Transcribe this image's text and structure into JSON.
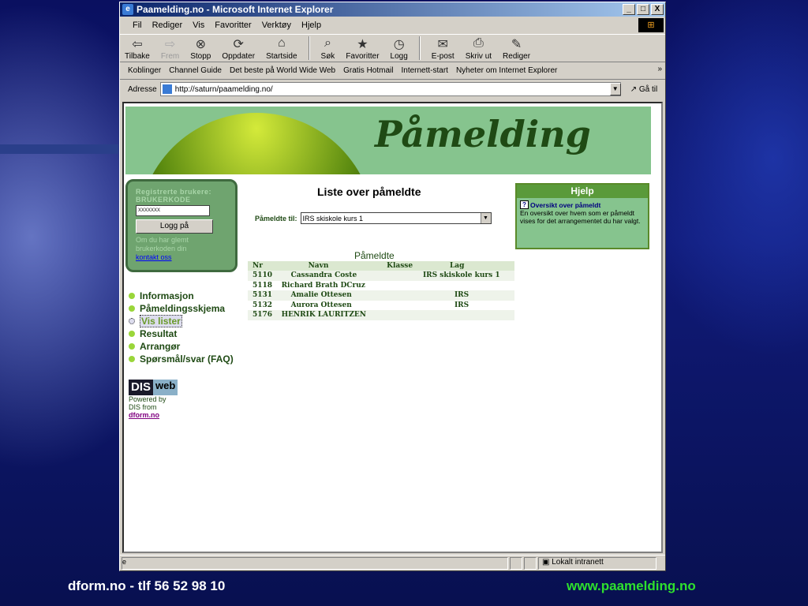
{
  "window": {
    "title": "Paamelding.no - Microsoft Internet Explorer",
    "buttons": [
      "_",
      "□",
      "X"
    ]
  },
  "menu": [
    "Fil",
    "Rediger",
    "Vis",
    "Favoritter",
    "Verktøy",
    "Hjelp"
  ],
  "toolbar": [
    {
      "label": "Tilbake",
      "icon": "back-icon",
      "glyph": "⇦"
    },
    {
      "label": "Frem",
      "icon": "forward-icon",
      "glyph": "⇨"
    },
    {
      "label": "Stopp",
      "icon": "stop-icon",
      "glyph": "⊗"
    },
    {
      "label": "Oppdater",
      "icon": "refresh-icon",
      "glyph": "⟳"
    },
    {
      "label": "Startside",
      "icon": "home-icon",
      "glyph": "⌂"
    },
    {
      "label": "Søk",
      "icon": "search-icon",
      "glyph": "⌕"
    },
    {
      "label": "Favoritter",
      "icon": "favorites-icon",
      "glyph": "★"
    },
    {
      "label": "Logg",
      "icon": "history-icon",
      "glyph": "◷"
    },
    {
      "label": "E-post",
      "icon": "mail-icon",
      "glyph": "✉"
    },
    {
      "label": "Skriv ut",
      "icon": "print-icon",
      "glyph": "⎙"
    },
    {
      "label": "Rediger",
      "icon": "edit-icon",
      "glyph": "✎"
    }
  ],
  "links": {
    "label": "Koblinger",
    "items": [
      "Channel Guide",
      "Det beste på World Wide Web",
      "Gratis Hotmail",
      "Internett-start",
      "Nyheter om Internet Explorer"
    ]
  },
  "address": {
    "label": "Adresse",
    "url": "http://saturn/paamelding.no/",
    "go": "Gå til"
  },
  "banner": {
    "title": "Påmelding"
  },
  "login": {
    "title": "Registrerte brukere:",
    "code_label": "BRUKERKODE",
    "code_value": "xxxxxxx",
    "button": "Logg på",
    "help_text": "Om du har glemt brukerkoden din",
    "contact": "kontakt oss"
  },
  "nav": [
    "Informasjon",
    "Påmeldingsskjema",
    "Vis lister",
    "Resultat",
    "Arrangør",
    "Spørsmål/svar (FAQ)"
  ],
  "dis": {
    "logo_a": "DIS",
    "logo_b": "web",
    "powered": "Powered by",
    "from": "DIS from",
    "link": "dform.no"
  },
  "list": {
    "title": "Liste over påmeldte",
    "filter_label": "Påmeldte til:",
    "filter_value": "IRS skiskole kurs 1",
    "table_title": "Påmeldte",
    "columns": [
      "Nr",
      "Navn",
      "Klasse",
      "Lag"
    ],
    "rows": [
      [
        "5110",
        "Cassandra Coste",
        "",
        "IRS skiskole kurs 1"
      ],
      [
        "5118",
        "Richard Brath DCruz",
        "",
        ""
      ],
      [
        "5131",
        "Amalie Ottesen",
        "",
        "IRS"
      ],
      [
        "5132",
        "Aurora Ottesen",
        "",
        "IRS"
      ],
      [
        "5176",
        "HENRIK LAURITZEN",
        "",
        ""
      ]
    ]
  },
  "help": {
    "title": "Hjelp",
    "topic": "Oversikt over påmeldt",
    "text": "En oversikt over hvem som er påmeldt vises for det arrangementet du har valgt."
  },
  "status": {
    "zone": "Lokalt intranett"
  },
  "footer": {
    "left": "dform.no - tlf  56 52 98 10",
    "right": "www.paamelding.no"
  }
}
